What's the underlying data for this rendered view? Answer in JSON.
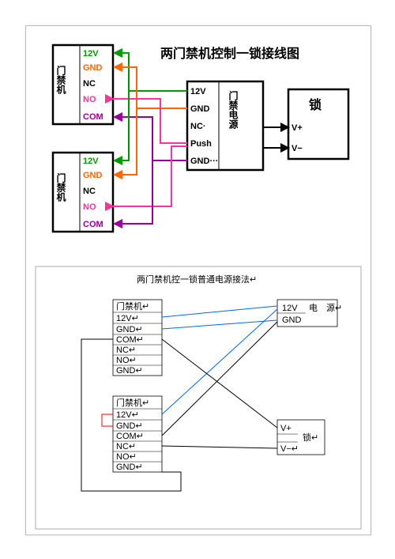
{
  "diagram1": {
    "title": "两门禁机控制一锁接线图",
    "acA": {
      "name": "门禁机",
      "pins": [
        "12V",
        "GND",
        "NC",
        "NO",
        "COM"
      ]
    },
    "acB": {
      "name": "门禁机",
      "pins": [
        "12V",
        "GND",
        "NC",
        "NO",
        "COM"
      ]
    },
    "psu": {
      "name": "门禁电源",
      "pins_left": [
        "12V",
        "GND",
        "NC·",
        "Push",
        "GND···"
      ]
    },
    "lock": {
      "name": "锁",
      "pins": [
        "V+",
        "V−"
      ]
    },
    "colors": {
      "12v": "#009900",
      "gnd": "#ff6600",
      "nc": "#000000",
      "no": "#ff3399",
      "com": "#990099"
    }
  },
  "diagram2": {
    "title": "两门禁机控一锁普通电源接法↵",
    "ac": {
      "name": "门禁机↵",
      "pins": [
        "12V↵",
        "GND↵",
        "COM↵",
        "NC↵",
        "NO↵",
        "GND↵"
      ]
    },
    "psu": {
      "label1": "12V",
      "label2": "GND",
      "name": "电　源↵"
    },
    "lock": {
      "name": "锁↵",
      "pins": [
        "V+",
        "V−↵"
      ]
    },
    "colors": {
      "blue": "#0066ff",
      "black": "#000000",
      "red": "#ff0000"
    }
  }
}
